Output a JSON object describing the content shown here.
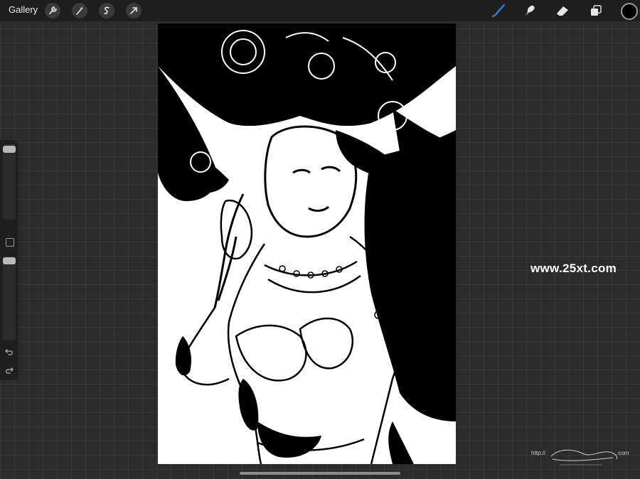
{
  "topbar": {
    "gallery_label": "Gallery",
    "left_tools": [
      "wrench-icon",
      "magic-wand-icon",
      "selection-icon",
      "transform-arrow-icon"
    ],
    "right_tools": [
      "brush-icon",
      "smudge-icon",
      "eraser-icon",
      "layers-icon"
    ],
    "active_tool": "brush-icon",
    "accent_color": "#2f7fe8",
    "current_color": "#000000"
  },
  "sidebar": {
    "brush_size_level": 0.1,
    "opacity_level": 0.1,
    "undo_icon": "undo-icon",
    "redo_icon": "redo-icon"
  },
  "watermark": {
    "text": "www.25xt.com"
  },
  "signature": {
    "prefix": "http://",
    "suffix": ".com"
  }
}
